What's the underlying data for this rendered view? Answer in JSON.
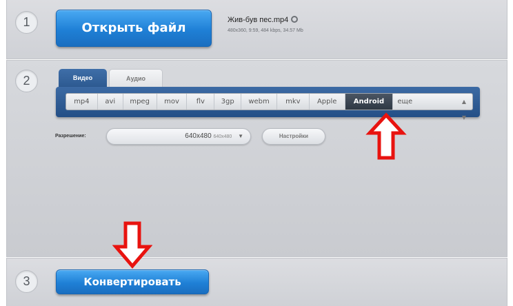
{
  "steps": {
    "one": "1",
    "two": "2",
    "three": "3"
  },
  "open_file": {
    "label": "Открыть файл"
  },
  "file": {
    "name": "Жив-був пес.mp4",
    "meta": "480x360, 9:59, 484 kbps, 34.57 Mb",
    "info_icon": "info-circle-icon"
  },
  "tabs": [
    {
      "label": "Видео",
      "active": true
    },
    {
      "label": "Аудио",
      "active": false
    }
  ],
  "formats": [
    "mp4",
    "avi",
    "mpeg",
    "mov",
    "flv",
    "3gp",
    "webm",
    "mkv",
    "Apple",
    "Android",
    "еще"
  ],
  "selected_format": "Android",
  "resolution": {
    "label": "Разрешение:",
    "value": "640x480",
    "sub": "640x480"
  },
  "settings_button": {
    "label": "Настройки"
  },
  "convert": {
    "label": "Конвертировать"
  },
  "annotations": {
    "color": "#e8130f",
    "icons": [
      "up-arrow-icon",
      "down-arrow-icon"
    ]
  },
  "colors": {
    "primary_button": "#1f80d6",
    "format_bar": "#2d5a91",
    "selected_format": "#3a4450"
  }
}
